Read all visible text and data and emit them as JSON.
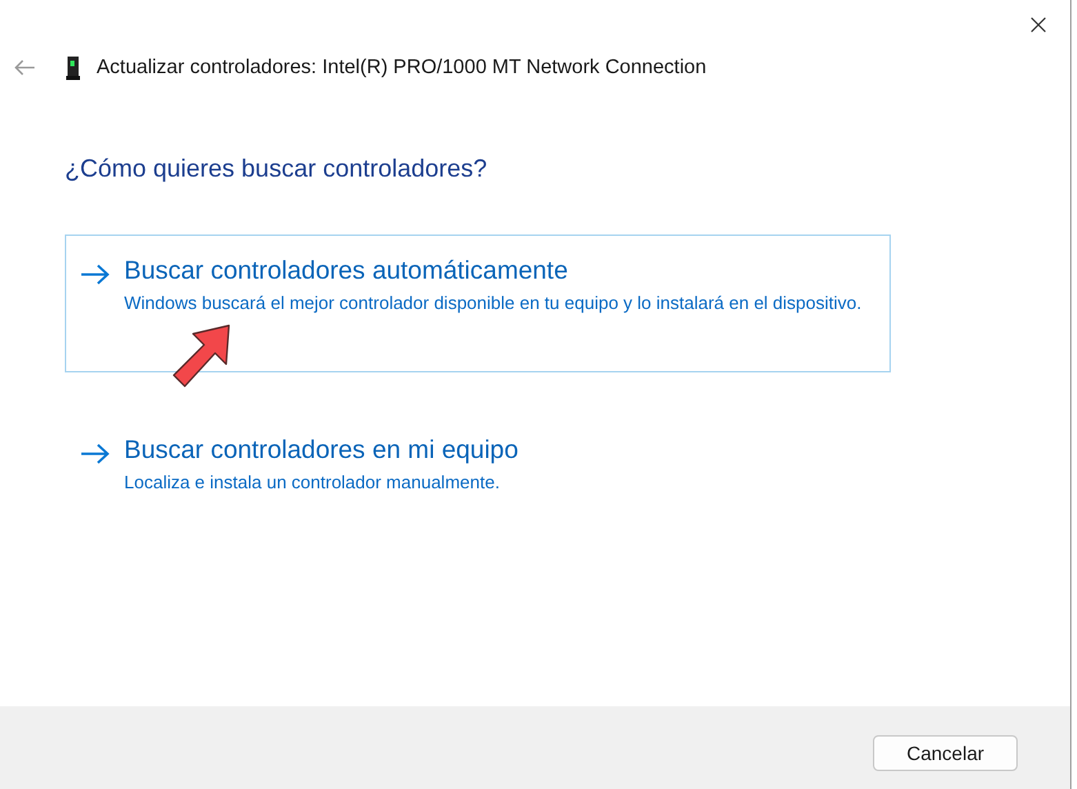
{
  "window": {
    "title": "Actualizar controladores: Intel(R) PRO/1000 MT Network Connection"
  },
  "question": "¿Cómo quieres buscar controladores?",
  "options": [
    {
      "title": "Buscar controladores automáticamente",
      "description": "Windows buscará el mejor controlador disponible en tu equipo y lo instalará en el dispositivo.",
      "selected": true
    },
    {
      "title": "Buscar controladores en mi equipo",
      "description": "Localiza e instala un controlador manualmente.",
      "selected": false
    }
  ],
  "buttons": [
    {
      "label": "Cancelar"
    }
  ]
}
